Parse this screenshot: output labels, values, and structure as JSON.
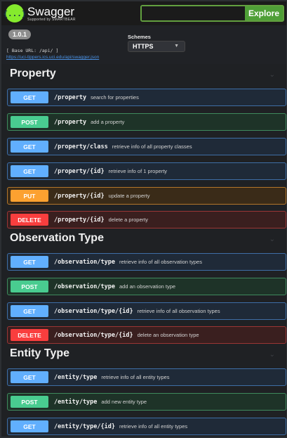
{
  "topbar": {
    "logo_title": "Swagger",
    "logo_sub": "Supported by SMARTBEAR",
    "logo_badge": "{...}",
    "explore_value": "",
    "explore_label": "Explore"
  },
  "info": {
    "version": "1.0.1",
    "base_url": "[ Base URL: /api/ ]",
    "spec_link": "https://uci-tippers.ics.uci.edu/api/swagger.json",
    "schemes_label": "Schemes",
    "schemes_selected": "HTTPS"
  },
  "sections": [
    {
      "title": "Property",
      "ops": [
        {
          "method": "GET",
          "path": "/property",
          "desc": "search for properties"
        },
        {
          "method": "POST",
          "path": "/property",
          "desc": "add a property"
        },
        {
          "method": "GET",
          "path": "/property/class",
          "desc": "retrieve info of all property classes"
        },
        {
          "method": "GET",
          "path": "/property/{id}",
          "desc": "retrieve info of 1 property"
        },
        {
          "method": "PUT",
          "path": "/property/{id}",
          "desc": "update a property"
        },
        {
          "method": "DELETE",
          "path": "/property/{id}",
          "desc": "delete a property"
        }
      ]
    },
    {
      "title": "Observation Type",
      "ops": [
        {
          "method": "GET",
          "path": "/observation/type",
          "desc": "retrieve info of all observation types"
        },
        {
          "method": "POST",
          "path": "/observation/type",
          "desc": "add an observation type"
        },
        {
          "method": "GET",
          "path": "/observation/type/{id}",
          "desc": "retrieve info of all observation types"
        },
        {
          "method": "DELETE",
          "path": "/observation/type/{id}",
          "desc": "delete an observation type"
        }
      ]
    },
    {
      "title": "Entity Type",
      "ops": [
        {
          "method": "GET",
          "path": "/entity/type",
          "desc": "retrieve info of all entity types"
        },
        {
          "method": "POST",
          "path": "/entity/type",
          "desc": "add new entity type"
        },
        {
          "method": "GET",
          "path": "/entity/type/{id}",
          "desc": "retrieve info of all entity types"
        }
      ]
    }
  ],
  "icons": {
    "section_toggle": "chevron-down-icon",
    "schemes_dropdown": "chevron-down-icon"
  },
  "colors": {
    "get": "#61affe",
    "post": "#49cc90",
    "put": "#fca130",
    "delete": "#f93e3e",
    "explore": "#4f9f37",
    "logo": "#85ea2d"
  }
}
